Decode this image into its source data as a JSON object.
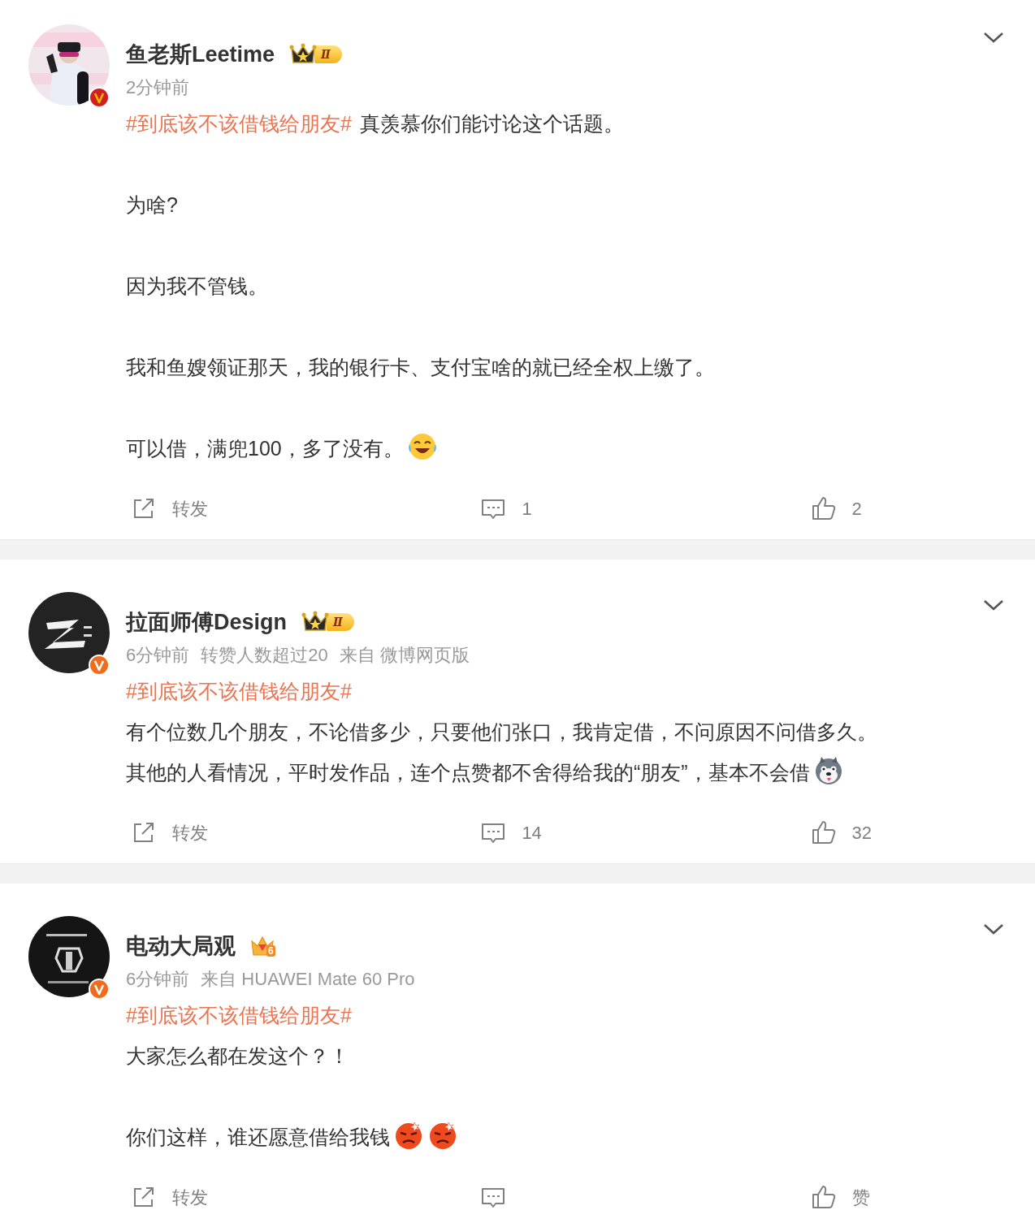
{
  "posts": [
    {
      "name": "鱼老斯Leetime",
      "badge": {
        "kind": "crown",
        "text": "Ⅱ"
      },
      "verified": {
        "kind": "gold"
      },
      "meta": [
        "2分钟前"
      ],
      "blocks": [
        {
          "lines": [
            {
              "topic": "#到底该不该借钱给朋友#",
              "text": "真羡慕你们能讨论这个话题。"
            }
          ]
        },
        {
          "lines": [
            {
              "text": "为啥?"
            }
          ]
        },
        {
          "lines": [
            {
              "text": "因为我不管钱。"
            }
          ]
        },
        {
          "lines": [
            {
              "text": "我和鱼嫂领证那天，我的银行卡、支付宝啥的就已经全权上缴了。"
            }
          ]
        },
        {
          "lines": [
            {
              "text": "可以借，满兜100，多了没有。",
              "emojis": [
                {
                  "kind": "laugh"
                }
              ]
            }
          ]
        }
      ],
      "actions": [
        {
          "kind": "forward",
          "label": "转发"
        },
        {
          "kind": "comment",
          "label": "1"
        },
        {
          "kind": "like",
          "label": "2"
        }
      ]
    },
    {
      "name": "拉面师傅Design",
      "badge": {
        "kind": "crown",
        "text": "Ⅱ"
      },
      "verified": {
        "kind": "orange"
      },
      "meta": [
        "6分钟前",
        "转赞人数超过20",
        "来自 微博网页版"
      ],
      "blocks": [
        {
          "lines": [
            {
              "topic": "#到底该不该借钱给朋友#"
            },
            {
              "text": "有个位数几个朋友，不论借多少，只要他们张口，我肯定借，不问原因不问借多久。"
            },
            {
              "text": "其他的人看情况，平时发作品，连个点赞都不舍得给我的“朋友”，基本不会借",
              "emojis": [
                {
                  "kind": "dog"
                }
              ]
            }
          ]
        }
      ],
      "actions": [
        {
          "kind": "forward",
          "label": "转发"
        },
        {
          "kind": "comment",
          "label": "14"
        },
        {
          "kind": "like",
          "label": "32"
        }
      ]
    },
    {
      "name": "电动大局观",
      "badge": {
        "kind": "gem",
        "text": "6"
      },
      "verified": {
        "kind": "orange"
      },
      "meta": [
        "6分钟前",
        "来自 HUAWEI Mate 60 Pro"
      ],
      "blocks": [
        {
          "lines": [
            {
              "topic": "#到底该不该借钱给朋友#"
            },
            {
              "text": "大家怎么都在发这个？！"
            }
          ]
        },
        {
          "lines": [
            {
              "text": "你们这样，谁还愿意借给我钱",
              "emojis": [
                {
                  "kind": "angry"
                },
                {
                  "kind": "angry"
                }
              ]
            }
          ]
        }
      ],
      "actions": [
        {
          "kind": "forward",
          "label": "转发"
        },
        {
          "kind": "comment"
        },
        {
          "kind": "like",
          "label": "赞"
        }
      ]
    }
  ]
}
